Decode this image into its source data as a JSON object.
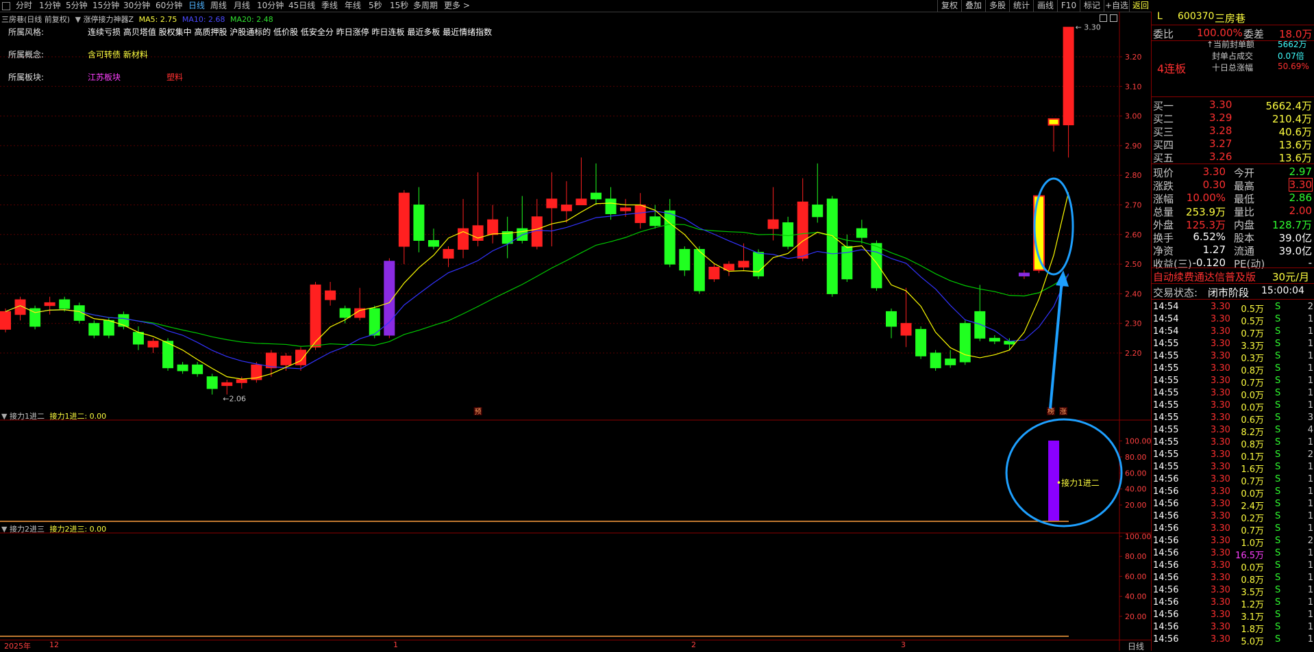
{
  "topbar": {
    "timeframes": [
      "分时",
      "1分钟",
      "5分钟",
      "15分钟",
      "30分钟",
      "60分钟",
      "日线",
      "周线",
      "月线",
      "10分钟",
      "45日线",
      "季线",
      "年线",
      "5秒",
      "15秒",
      "多周期",
      "更多 >"
    ],
    "active_timeframe": "日线",
    "buttons": [
      "复权",
      "叠加",
      "多股",
      "统计",
      "画线",
      "F10",
      "标记",
      "+自选",
      "返回"
    ]
  },
  "main_chart": {
    "title": "三房巷(日线 前复权)",
    "indicator": "涨停接力神器Z",
    "ma5_label": "MA5: 2.75",
    "ma10_label": "MA10: 2.68",
    "ma20_label": "MA20: 2.48",
    "ma5_color": "#ffff00",
    "ma10_color": "#3333ff",
    "ma20_color": "#00cc00",
    "high_label": "3.30",
    "low_label": "2.06",
    "markers": [
      "预",
      "榜",
      "涨"
    ],
    "y_ticks": [
      "3.20",
      "3.10",
      "3.00",
      "2.90",
      "2.80",
      "2.70",
      "2.60",
      "2.50",
      "2.40",
      "2.30",
      "2.20"
    ],
    "candles": [
      {
        "o": 2.28,
        "c": 2.34,
        "h": 2.35,
        "l": 2.27
      },
      {
        "o": 2.33,
        "c": 2.38,
        "h": 2.39,
        "l": 2.31
      },
      {
        "o": 2.35,
        "c": 2.29,
        "h": 2.36,
        "l": 2.28
      },
      {
        "o": 2.36,
        "c": 2.37,
        "h": 2.39,
        "l": 2.33
      },
      {
        "o": 2.38,
        "c": 2.35,
        "h": 2.39,
        "l": 2.34
      },
      {
        "o": 2.36,
        "c": 2.31,
        "h": 2.37,
        "l": 2.3
      },
      {
        "o": 2.3,
        "c": 2.26,
        "h": 2.31,
        "l": 2.25
      },
      {
        "o": 2.31,
        "c": 2.26,
        "h": 2.32,
        "l": 2.25
      },
      {
        "o": 2.33,
        "c": 2.29,
        "h": 2.34,
        "l": 2.28
      },
      {
        "o": 2.27,
        "c": 2.23,
        "h": 2.29,
        "l": 2.21
      },
      {
        "o": 2.22,
        "c": 2.24,
        "h": 2.25,
        "l": 2.2
      },
      {
        "o": 2.24,
        "c": 2.15,
        "h": 2.25,
        "l": 2.14
      },
      {
        "o": 2.16,
        "c": 2.14,
        "h": 2.17,
        "l": 2.13
      },
      {
        "o": 2.16,
        "c": 2.13,
        "h": 2.17,
        "l": 2.12
      },
      {
        "o": 2.12,
        "c": 2.08,
        "h": 2.13,
        "l": 2.06
      },
      {
        "o": 2.09,
        "c": 2.1,
        "h": 2.11,
        "l": 2.06
      },
      {
        "o": 2.1,
        "c": 2.11,
        "h": 2.12,
        "l": 2.08
      },
      {
        "o": 2.11,
        "c": 2.16,
        "h": 2.17,
        "l": 2.1
      },
      {
        "o": 2.15,
        "c": 2.2,
        "h": 2.21,
        "l": 2.12
      },
      {
        "o": 2.16,
        "c": 2.19,
        "h": 2.2,
        "l": 2.14
      },
      {
        "o": 2.16,
        "c": 2.21,
        "h": 2.22,
        "l": 2.14
      },
      {
        "o": 2.22,
        "c": 2.43,
        "h": 2.44,
        "l": 2.21
      },
      {
        "o": 2.38,
        "c": 2.41,
        "h": 2.44,
        "l": 2.36
      },
      {
        "o": 2.35,
        "c": 2.32,
        "h": 2.36,
        "l": 2.3
      },
      {
        "o": 2.32,
        "c": 2.35,
        "h": 2.42,
        "l": 2.31
      },
      {
        "o": 2.35,
        "c": 2.26,
        "h": 2.36,
        "l": 2.25
      },
      {
        "o": 2.26,
        "c": 2.51,
        "h": 2.52,
        "l": 2.25
      },
      {
        "o": 2.56,
        "c": 2.74,
        "h": 2.75,
        "l": 2.5
      },
      {
        "o": 2.7,
        "c": 2.58,
        "h": 2.76,
        "l": 2.54
      },
      {
        "o": 2.58,
        "c": 2.56,
        "h": 2.62,
        "l": 2.55
      },
      {
        "o": 2.52,
        "c": 2.55,
        "h": 2.56,
        "l": 2.49
      },
      {
        "o": 2.55,
        "c": 2.62,
        "h": 2.72,
        "l": 2.52
      },
      {
        "o": 2.58,
        "c": 2.63,
        "h": 2.81,
        "l": 2.56
      },
      {
        "o": 2.6,
        "c": 2.65,
        "h": 2.7,
        "l": 2.57
      },
      {
        "o": 2.61,
        "c": 2.57,
        "h": 2.66,
        "l": 2.52
      },
      {
        "o": 2.62,
        "c": 2.58,
        "h": 2.73,
        "l": 2.57
      },
      {
        "o": 2.56,
        "c": 2.66,
        "h": 2.72,
        "l": 2.55
      },
      {
        "o": 2.69,
        "c": 2.72,
        "h": 2.81,
        "l": 2.56
      },
      {
        "o": 2.68,
        "c": 2.7,
        "h": 2.78,
        "l": 2.64
      },
      {
        "o": 2.7,
        "c": 2.72,
        "h": 2.86,
        "l": 2.7
      },
      {
        "o": 2.74,
        "c": 2.72,
        "h": 2.84,
        "l": 2.7
      },
      {
        "o": 2.72,
        "c": 2.67,
        "h": 2.76,
        "l": 2.65
      },
      {
        "o": 2.68,
        "c": 2.69,
        "h": 2.72,
        "l": 2.66
      },
      {
        "o": 2.64,
        "c": 2.7,
        "h": 2.74,
        "l": 2.62
      },
      {
        "o": 2.66,
        "c": 2.63,
        "h": 2.7,
        "l": 2.62
      },
      {
        "o": 2.68,
        "c": 2.5,
        "h": 2.72,
        "l": 2.49
      },
      {
        "o": 2.55,
        "c": 2.48,
        "h": 2.56,
        "l": 2.46
      },
      {
        "o": 2.55,
        "c": 2.41,
        "h": 2.56,
        "l": 2.4
      },
      {
        "o": 2.45,
        "c": 2.49,
        "h": 2.5,
        "l": 2.44
      },
      {
        "o": 2.48,
        "c": 2.5,
        "h": 2.51,
        "l": 2.46
      },
      {
        "o": 2.49,
        "c": 2.51,
        "h": 2.57,
        "l": 2.48
      },
      {
        "o": 2.54,
        "c": 2.46,
        "h": 2.55,
        "l": 2.45
      },
      {
        "o": 2.62,
        "c": 2.65,
        "h": 2.76,
        "l": 2.58
      },
      {
        "o": 2.64,
        "c": 2.56,
        "h": 2.66,
        "l": 2.55
      },
      {
        "o": 2.52,
        "c": 2.71,
        "h": 2.79,
        "l": 2.51
      },
      {
        "o": 2.7,
        "c": 2.66,
        "h": 2.84,
        "l": 2.64
      },
      {
        "o": 2.72,
        "c": 2.4,
        "h": 2.73,
        "l": 2.39
      },
      {
        "o": 2.56,
        "c": 2.45,
        "h": 2.6,
        "l": 2.44
      },
      {
        "o": 2.62,
        "c": 2.59,
        "h": 2.65,
        "l": 2.57
      },
      {
        "o": 2.57,
        "c": 2.42,
        "h": 2.58,
        "l": 2.41
      },
      {
        "o": 2.34,
        "c": 2.29,
        "h": 2.35,
        "l": 2.25
      },
      {
        "o": 2.26,
        "c": 2.3,
        "h": 2.42,
        "l": 2.22
      },
      {
        "o": 2.28,
        "c": 2.19,
        "h": 2.29,
        "l": 2.18
      },
      {
        "o": 2.2,
        "c": 2.15,
        "h": 2.21,
        "l": 2.14
      },
      {
        "o": 2.18,
        "c": 2.16,
        "h": 2.21,
        "l": 2.15
      },
      {
        "o": 2.3,
        "c": 2.17,
        "h": 2.31,
        "l": 2.16
      },
      {
        "o": 2.34,
        "c": 2.25,
        "h": 2.43,
        "l": 2.24
      },
      {
        "o": 2.25,
        "c": 2.24,
        "h": 2.26,
        "l": 2.23
      },
      {
        "o": 2.24,
        "c": 2.23,
        "h": 2.25,
        "l": 2.21
      },
      {
        "o": 2.47,
        "c": 2.46,
        "h": 2.48,
        "l": 2.45
      },
      {
        "o": 2.48,
        "c": 2.73,
        "h": 2.73,
        "l": 2.47
      },
      {
        "o": 2.97,
        "c": 2.99,
        "h": 2.99,
        "l": 2.88
      },
      {
        "o": 2.97,
        "c": 3.3,
        "h": 3.3,
        "l": 2.86
      }
    ],
    "special_candles": [
      26,
      69
    ],
    "limit_candles": [
      70,
      71
    ]
  },
  "info_panel": {
    "rows": [
      {
        "label": "所属风格:",
        "value": "连续亏损 高贝塔值 股权集中 高质押股 沪股通标的 低价股 低安全分 昨日涨停 昨日连板 最近多板 最近情绪指数",
        "color": "#ffffff"
      },
      {
        "label": "所属概念:",
        "value": "含可转债 新材料",
        "color": "#ffff40"
      },
      {
        "label": "所属板块:",
        "value": "江苏板块",
        "color": "#ff40ff",
        "extra": "塑料",
        "extra_color": "#ff3030"
      }
    ]
  },
  "indicator1": {
    "title": "接力1进二",
    "value_label": "接力1进二: 0.00",
    "note": "接力1进二",
    "y_ticks": [
      "100.00",
      "80.00",
      "60.00",
      "40.00",
      "20.00"
    ],
    "bar_value": 100
  },
  "indicator2": {
    "title": "接力2进三",
    "value_label": "接力2进三: 0.00",
    "y_ticks": [
      "100.00",
      "80.00",
      "60.00",
      "40.00",
      "20.00"
    ]
  },
  "x_axis": {
    "labels": [
      "2025年",
      "12",
      "1",
      "2",
      "3"
    ],
    "mode": "日线"
  },
  "right_panel": {
    "header": {
      "prefix": "L",
      "code": "600370",
      "name": "三房巷"
    },
    "weibi": {
      "label": "委比",
      "value": "100.00%",
      "diff_label": "委差",
      "diff": "18.0万"
    },
    "board": "4连板",
    "board_stats": [
      {
        "label": "↑当前封单额",
        "value": "5662万",
        "color": "#40ffff"
      },
      {
        "label": "封单占成交",
        "value": "0.07倍",
        "color": "#40ffff"
      },
      {
        "label": "十日总涨幅",
        "value": "50.69%",
        "color": "#ff3030"
      }
    ],
    "bids": [
      {
        "label": "买一",
        "price": "3.30",
        "vol": "5662.4万"
      },
      {
        "label": "买二",
        "price": "3.29",
        "vol": "210.4万"
      },
      {
        "label": "买三",
        "price": "3.28",
        "vol": "40.6万"
      },
      {
        "label": "买四",
        "price": "3.27",
        "vol": "13.6万"
      },
      {
        "label": "买五",
        "price": "3.26",
        "vol": "13.6万"
      }
    ],
    "quote": [
      [
        "现价",
        "3.30",
        "今开",
        "2.97"
      ],
      [
        "涨跌",
        "0.30",
        "最高",
        "3.30"
      ],
      [
        "涨幅",
        "10.00%",
        "最低",
        "2.86"
      ],
      [
        "总量",
        "253.9万",
        "量比",
        "2.00"
      ],
      [
        "外盘",
        "125.3万",
        "内盘",
        "128.7万"
      ],
      [
        "换手",
        "6.52%",
        "股本",
        "39.0亿"
      ],
      [
        "净资",
        "1.27",
        "流通",
        "39.0亿"
      ],
      [
        "收益(三)",
        "-0.120",
        "PE(动)",
        "-"
      ]
    ],
    "ad": "自动续费通达信普及版",
    "ad_price": "30元/月",
    "status_label": "交易状态:",
    "status": "闭市阶段",
    "status_time": "15:00:04",
    "ticks": [
      [
        "14:54",
        "3.30",
        "0.5万",
        "S",
        "2"
      ],
      [
        "14:54",
        "3.30",
        "0.5万",
        "S",
        "1"
      ],
      [
        "14:54",
        "3.30",
        "0.7万",
        "S",
        "1"
      ],
      [
        "14:55",
        "3.30",
        "3.3万",
        "S",
        "1"
      ],
      [
        "14:55",
        "3.30",
        "0.3万",
        "S",
        "1"
      ],
      [
        "14:55",
        "3.30",
        "0.8万",
        "S",
        "1"
      ],
      [
        "14:55",
        "3.30",
        "0.7万",
        "S",
        "1"
      ],
      [
        "14:55",
        "3.30",
        "0.0万",
        "S",
        "1"
      ],
      [
        "14:55",
        "3.30",
        "0.0万",
        "S",
        "1"
      ],
      [
        "14:55",
        "3.30",
        "0.6万",
        "S",
        "3"
      ],
      [
        "14:55",
        "3.30",
        "8.2万",
        "S",
        "4"
      ],
      [
        "14:55",
        "3.30",
        "0.8万",
        "S",
        "1"
      ],
      [
        "14:55",
        "3.30",
        "0.1万",
        "S",
        "2"
      ],
      [
        "14:55",
        "3.30",
        "1.6万",
        "S",
        "1"
      ],
      [
        "14:56",
        "3.30",
        "0.7万",
        "S",
        "1"
      ],
      [
        "14:56",
        "3.30",
        "0.0万",
        "S",
        "1"
      ],
      [
        "14:56",
        "3.30",
        "2.4万",
        "S",
        "1"
      ],
      [
        "14:56",
        "3.30",
        "0.2万",
        "S",
        "1"
      ],
      [
        "14:56",
        "3.30",
        "0.7万",
        "S",
        "1"
      ],
      [
        "14:56",
        "3.30",
        "1.0万",
        "S",
        "2"
      ],
      [
        "14:56",
        "3.30",
        "16.5万",
        "S",
        "1"
      ],
      [
        "14:56",
        "3.30",
        "0.0万",
        "S",
        "1"
      ],
      [
        "14:56",
        "3.30",
        "0.8万",
        "S",
        "1"
      ],
      [
        "14:56",
        "3.30",
        "3.5万",
        "S",
        "1"
      ],
      [
        "14:56",
        "3.30",
        "1.2万",
        "S",
        "1"
      ],
      [
        "14:56",
        "3.30",
        "3.1万",
        "S",
        "1"
      ],
      [
        "14:56",
        "3.30",
        "1.8万",
        "S",
        "1"
      ],
      [
        "14:56",
        "3.30",
        "5.0万",
        "S",
        "1"
      ]
    ],
    "tick_highlight": [
      20
    ]
  }
}
